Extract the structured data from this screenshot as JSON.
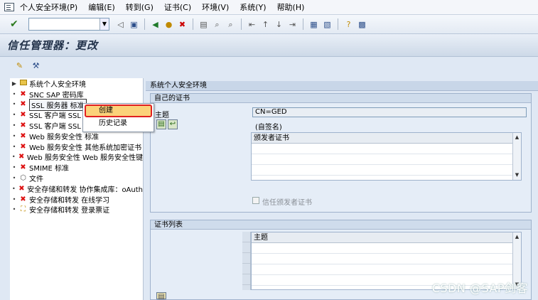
{
  "menu": {
    "items": [
      "个人安全环境(P)",
      "编辑(E)",
      "转到(G)",
      "证书(C)",
      "环境(V)",
      "系统(Y)",
      "帮助(H)"
    ]
  },
  "page_title": "信任管理器：更改",
  "tree": {
    "items": [
      {
        "label": "系统个人安全环境",
        "icon": "folder"
      },
      {
        "label": "SNC SAP 密码库",
        "icon": "x"
      },
      {
        "label": "SSL 服务器 标准",
        "icon": "x",
        "selected": true
      },
      {
        "label": "SSL 客户端 SSL",
        "icon": "x"
      },
      {
        "label": "SSL 客户端 SSL",
        "icon": "x"
      },
      {
        "label": "Web 服务安全性 标准",
        "icon": "x"
      },
      {
        "label": "Web 服务安全性 其他系统加密证书",
        "icon": "x"
      },
      {
        "label": "Web 服务安全性 Web 服务安全性键",
        "icon": "x"
      },
      {
        "label": "SMIME 标准",
        "icon": "x"
      },
      {
        "label": "文件",
        "icon": "cube"
      },
      {
        "label": "安全存储和转发 协作集成库：oAuth",
        "icon": "x"
      },
      {
        "label": "安全存储和转发 在线学习",
        "icon": "x"
      },
      {
        "label": "安全存储和转发 登录票证",
        "icon": "logon"
      }
    ]
  },
  "context_menu": {
    "create": "创建",
    "history": "历史记录"
  },
  "right": {
    "header": "系统个人安全环境",
    "own_cert": {
      "title": "自己的证书",
      "subject_label": "主题",
      "subject_value": "CN=GED",
      "self_signed": "(自签名)",
      "issuer_col": "颁发者证书",
      "trust_issuer": "信任颁发者证书"
    },
    "cert_list": {
      "title": "证书列表",
      "subject_col": "主题"
    }
  },
  "watermark": "CSDN @SAP剑客"
}
